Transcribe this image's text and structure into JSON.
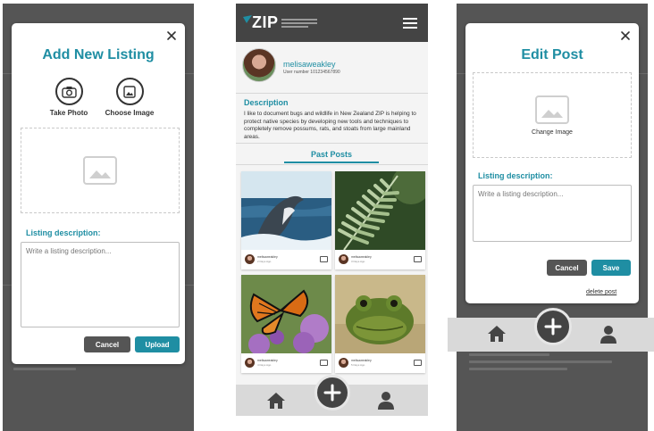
{
  "add_listing": {
    "title": "Add New Listing",
    "take_photo_label": "Take Photo",
    "choose_image_label": "Choose Image",
    "description_label": "Listing description:",
    "description_placeholder": "Write a listing description...",
    "cancel_label": "Cancel",
    "upload_label": "Upload"
  },
  "profile": {
    "logo_text": "ZIP",
    "username": "melisaweakley",
    "user_number": "User number 101234567890",
    "description_heading": "Description",
    "description_body": "I like to document bugs and wildlife in New Zealand ZIP is helping to protect native species by developing new tools and techniques to completely remove possums, rats, and stoats from large mainland areas.",
    "tab_label": "Past Posts",
    "posts": [
      {
        "image": "whale",
        "author": "melisaweakley",
        "date": "2 Days Ago"
      },
      {
        "image": "fern",
        "author": "melisaweakley",
        "date": "3 Days Ago"
      },
      {
        "image": "butterfly",
        "author": "melisaweakley",
        "date": "4 Days Ago"
      },
      {
        "image": "frog",
        "author": "melisaweakley",
        "date": "5 Days Ago"
      }
    ]
  },
  "edit_post": {
    "title": "Edit Post",
    "change_image_label": "Change Image",
    "description_label": "Listing description:",
    "description_placeholder": "Write a listing description...",
    "cancel_label": "Cancel",
    "save_label": "Save",
    "delete_label": "delete post"
  },
  "colors": {
    "accent": "#1f8ea3",
    "topbar": "#444444",
    "overlay": "#555555",
    "nav_bg": "#d9d9d9"
  },
  "icons": [
    "close-icon",
    "camera-icon",
    "image-icon",
    "hamburger-icon",
    "home-icon",
    "plus-icon",
    "user-icon"
  ]
}
